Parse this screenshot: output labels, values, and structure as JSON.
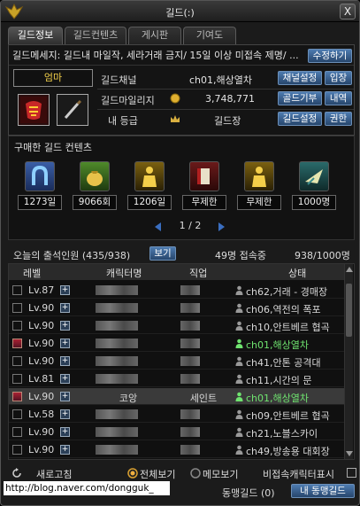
{
  "window": {
    "title": "길드(:)",
    "close_glyph": "X"
  },
  "tabs": [
    {
      "label": "길드정보",
      "active": true
    },
    {
      "label": "길드컨텐츠",
      "active": false
    },
    {
      "label": "게시판",
      "active": false
    },
    {
      "label": "기여도",
      "active": false
    }
  ],
  "info": {
    "notice": "길드메세지: 길드내 마일작, 세라거래 금지/ 15일 이상 미접속 제명/ ...",
    "edit_btn": "수정하기",
    "emblem_name": "엄마",
    "channel_label": "길드채널",
    "channel_value": "ch01,해상열차",
    "channel_btn1": "채널설정",
    "channel_btn2": "입장",
    "mileage_label": "길드마일리지",
    "mileage_value": "3,748,771",
    "mileage_btn1": "골드기부",
    "mileage_btn2": "내역",
    "rank_label": "내 등급",
    "rank_value": "길드장",
    "rank_btn1": "길드설정",
    "rank_btn2": "권한"
  },
  "contents": {
    "title": "구매한 길드 컨텐츠",
    "items": [
      {
        "value": "1273일",
        "icon": "horseshoe-icon",
        "color": "#2a4c8a"
      },
      {
        "value": "9066회",
        "icon": "pouch-icon",
        "color": "#2f6a1e"
      },
      {
        "value": "1206일",
        "icon": "golden-statue-icon",
        "color": "#9a7a10"
      },
      {
        "value": "무제한",
        "icon": "scroll-book-icon",
        "color": "#7a2020"
      },
      {
        "value": "무제한",
        "icon": "golden-statue-icon",
        "color": "#9a7a10"
      },
      {
        "value": "1000명",
        "icon": "winged-banner-icon",
        "color": "#2a6a6a"
      }
    ],
    "page": "1 / 2"
  },
  "attendance": {
    "label": "오늘의 출석인원 (435/938)",
    "view_btn": "보기",
    "online": "49명 접속중",
    "members": "938/1000명"
  },
  "table": {
    "headers": [
      "레벨",
      "캐릭터명",
      "직업",
      "상태"
    ],
    "rows": [
      {
        "level": "Lv.87",
        "name": "",
        "job": "",
        "status": "ch62,거래 - 경매장",
        "online": false,
        "avatar": false,
        "selected": false
      },
      {
        "level": "Lv.90",
        "name": "",
        "job": "",
        "status": "ch06,역전의 폭포",
        "online": false,
        "avatar": false,
        "selected": false
      },
      {
        "level": "Lv.90",
        "name": "",
        "job": "",
        "status": "ch10,안트베르 협곡",
        "online": false,
        "avatar": false,
        "selected": false
      },
      {
        "level": "Lv.90",
        "name": "",
        "job": "",
        "status": "ch01,해상열차",
        "online": true,
        "avatar": true,
        "selected": false
      },
      {
        "level": "Lv.90",
        "name": "",
        "job": "",
        "status": "ch41,안톤 공격대",
        "online": false,
        "avatar": false,
        "selected": false
      },
      {
        "level": "Lv.81",
        "name": "",
        "job": "",
        "status": "ch11,시간의 문",
        "online": false,
        "avatar": false,
        "selected": false
      },
      {
        "level": "Lv.90",
        "name": "코앙",
        "job": "세인트",
        "status": "ch01,해상열차",
        "online": true,
        "avatar": true,
        "selected": true
      },
      {
        "level": "Lv.58",
        "name": "",
        "job": "",
        "status": "ch09,안트베르 협곡",
        "online": false,
        "avatar": false,
        "selected": false
      },
      {
        "level": "Lv.90",
        "name": "",
        "job": "",
        "status": "ch21,노블스카이",
        "online": false,
        "avatar": false,
        "selected": false
      },
      {
        "level": "Lv.90",
        "name": "",
        "job": "",
        "status": "ch49,방송용 대회장",
        "online": false,
        "avatar": false,
        "selected": false
      }
    ]
  },
  "footer": {
    "refresh": "새로고침",
    "view_all": "전체보기",
    "memo_view": "메모보기",
    "hide_offline": "비접속캐릭터표시",
    "ally_label": "동맹길드 (0)",
    "ally_btn": "내 동맹길드",
    "url": "http://blog.naver.com/dongguk_"
  },
  "colors": {
    "accent_blue": "#3f6ea6",
    "online_green": "#6fe36f",
    "gold": "#f2d04a"
  }
}
